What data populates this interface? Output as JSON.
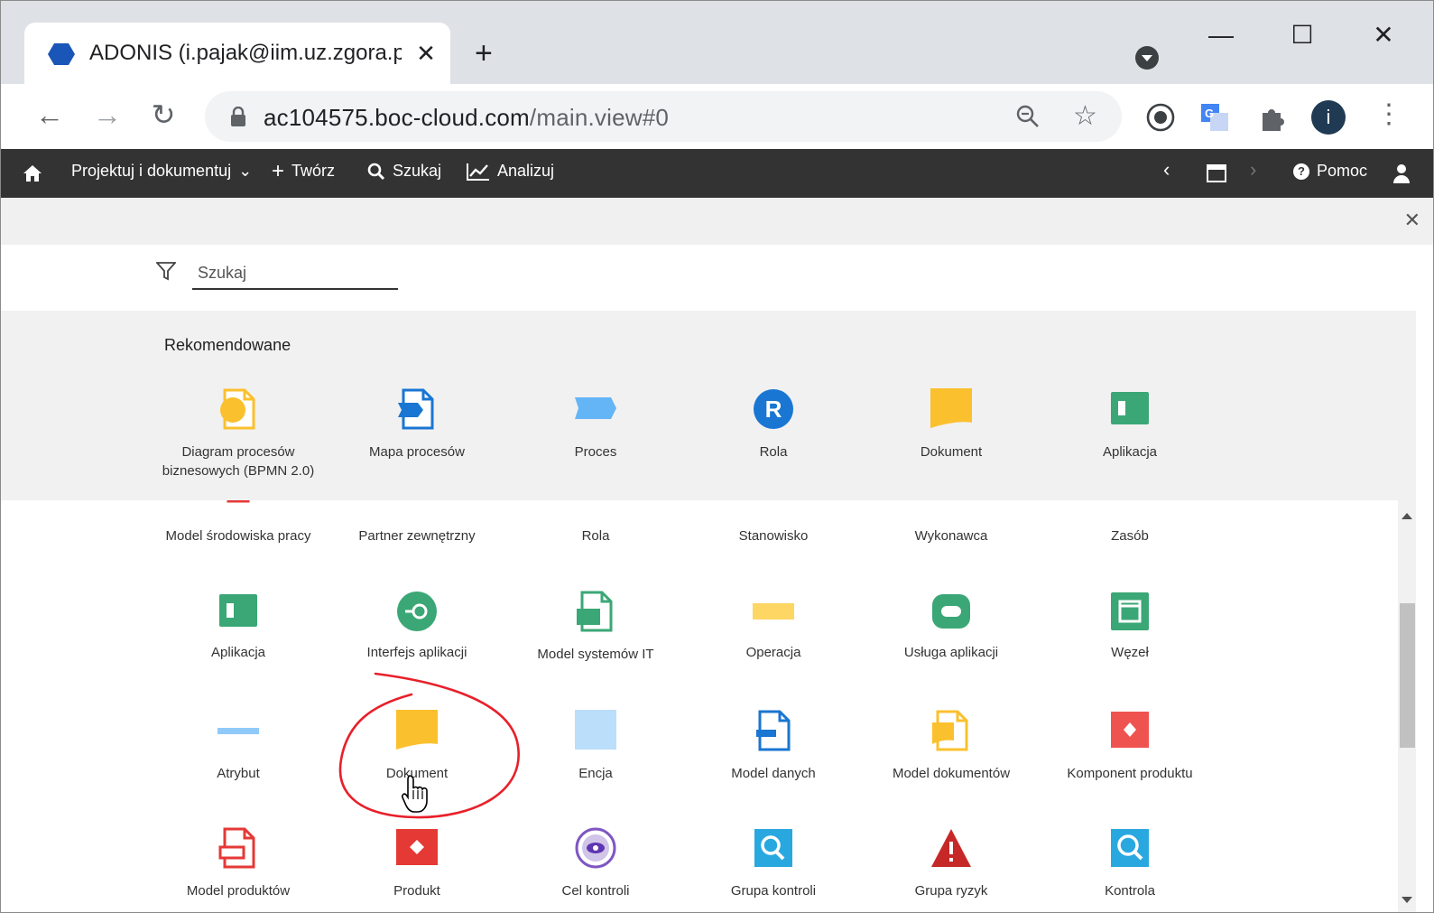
{
  "browser": {
    "tab_title": "ADONIS (i.pajak@iim.uz.zgora.pl)",
    "tab_close": "✕",
    "new_tab": "+",
    "url_host": "ac104575.boc-cloud.com",
    "url_path": "/main.view#0",
    "profile_initial": "i",
    "minimize": "—",
    "maximize": "☐",
    "close": "✕"
  },
  "nav": {
    "design_label": "Projektuj i dokumentuj",
    "create_label": "Twórz",
    "search_label": "Szukaj",
    "analyze_label": "Analizuj",
    "help_label": "Pomoc"
  },
  "search": {
    "placeholder": "Szukaj"
  },
  "recommended": {
    "title": "Rekomendowane",
    "items": [
      {
        "label": "Diagram procesów biznesowych (BPMN 2.0)",
        "icon": "bpmn-diagram-icon"
      },
      {
        "label": "Mapa procesów",
        "icon": "process-map-icon"
      },
      {
        "label": "Proces",
        "icon": "process-icon"
      },
      {
        "label": "Rola",
        "icon": "role-icon"
      },
      {
        "label": "Dokument",
        "icon": "document-icon"
      },
      {
        "label": "Aplikacja",
        "icon": "application-icon"
      }
    ]
  },
  "grid": {
    "row1": [
      "Model środowiska pracy",
      "Partner zewnętrzny",
      "Rola",
      "Stanowisko",
      "Wykonawca",
      "Zasób"
    ],
    "row2": [
      "Aplikacja",
      "Interfejs aplikacji",
      "Model systemów IT",
      "Operacja",
      "Usługa aplikacji",
      "Węzeł"
    ],
    "row3": [
      "Atrybut",
      "Dokument",
      "Encja",
      "Model danych",
      "Model dokumentów",
      "Komponent produktu"
    ],
    "row4": [
      "Model produktów",
      "Produkt",
      "Cel kontroli",
      "Grupa kontroli",
      "Grupa ryzyk",
      "Kontrola"
    ]
  },
  "colors": {
    "yellow": "#FBC02D",
    "blue": "#4A90D9",
    "light_blue": "#90CAF9",
    "green": "#3BA776",
    "red": "#E53935",
    "dark": "#333333",
    "annotation": "#E8202A"
  }
}
